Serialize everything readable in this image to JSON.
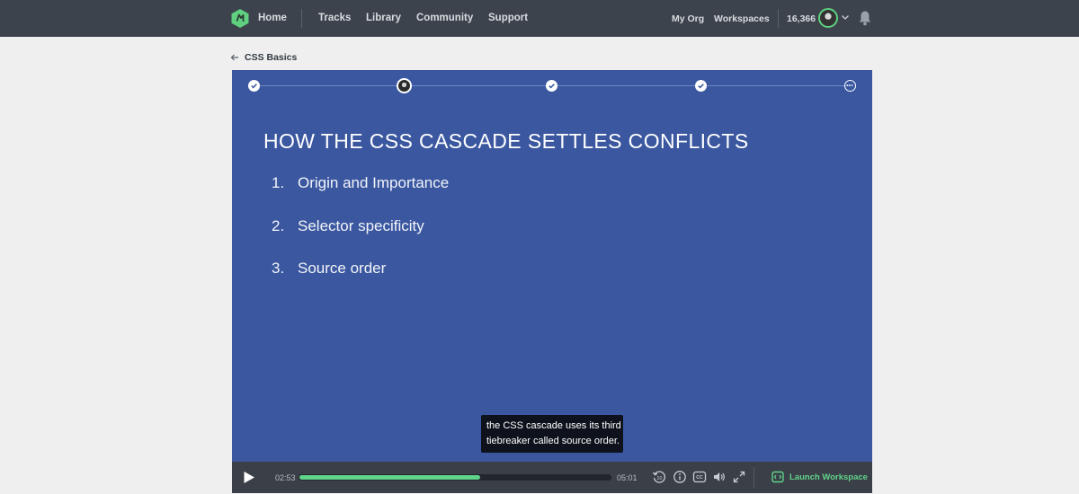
{
  "nav": {
    "home_label": "Home",
    "tracks_label": "Tracks",
    "library_label": "Library",
    "community_label": "Community",
    "support_label": "Support",
    "my_org_label": "My Org",
    "workspaces_label": "Workspaces",
    "points": "16,366",
    "logo_icon": "treehouse-logo-icon",
    "accent_color": "#5fcf80"
  },
  "breadcrumb": {
    "label": "CSS Basics",
    "icon": "arrow-left-icon"
  },
  "player": {
    "background_color": "#3a57a0",
    "steps": [
      {
        "state": "completed",
        "icon": "check-icon"
      },
      {
        "state": "current",
        "icon": "avatar-icon"
      },
      {
        "state": "completed",
        "icon": "check-icon"
      },
      {
        "state": "completed",
        "icon": "check-icon"
      },
      {
        "state": "more",
        "icon": "more-icon"
      }
    ],
    "slide": {
      "title": "HOW THE CSS CASCADE SETTLES CONFLICTS",
      "items": [
        {
          "num": "1.",
          "text": "Origin and Importance"
        },
        {
          "num": "2.",
          "text": "Selector specificity"
        },
        {
          "num": "3.",
          "text": "Source order"
        }
      ]
    },
    "caption": {
      "line1": "the CSS cascade uses its third",
      "line2": "tiebreaker called source order."
    },
    "controls": {
      "current_time": "02:53",
      "duration": "05:01",
      "progress": 0.58,
      "launch_label": "Launch Workspace",
      "icons": [
        "play-icon",
        "rewind-10-icon",
        "info-icon",
        "closed-captions-icon",
        "volume-icon",
        "fullscreen-icon",
        "workspace-icon"
      ]
    }
  }
}
